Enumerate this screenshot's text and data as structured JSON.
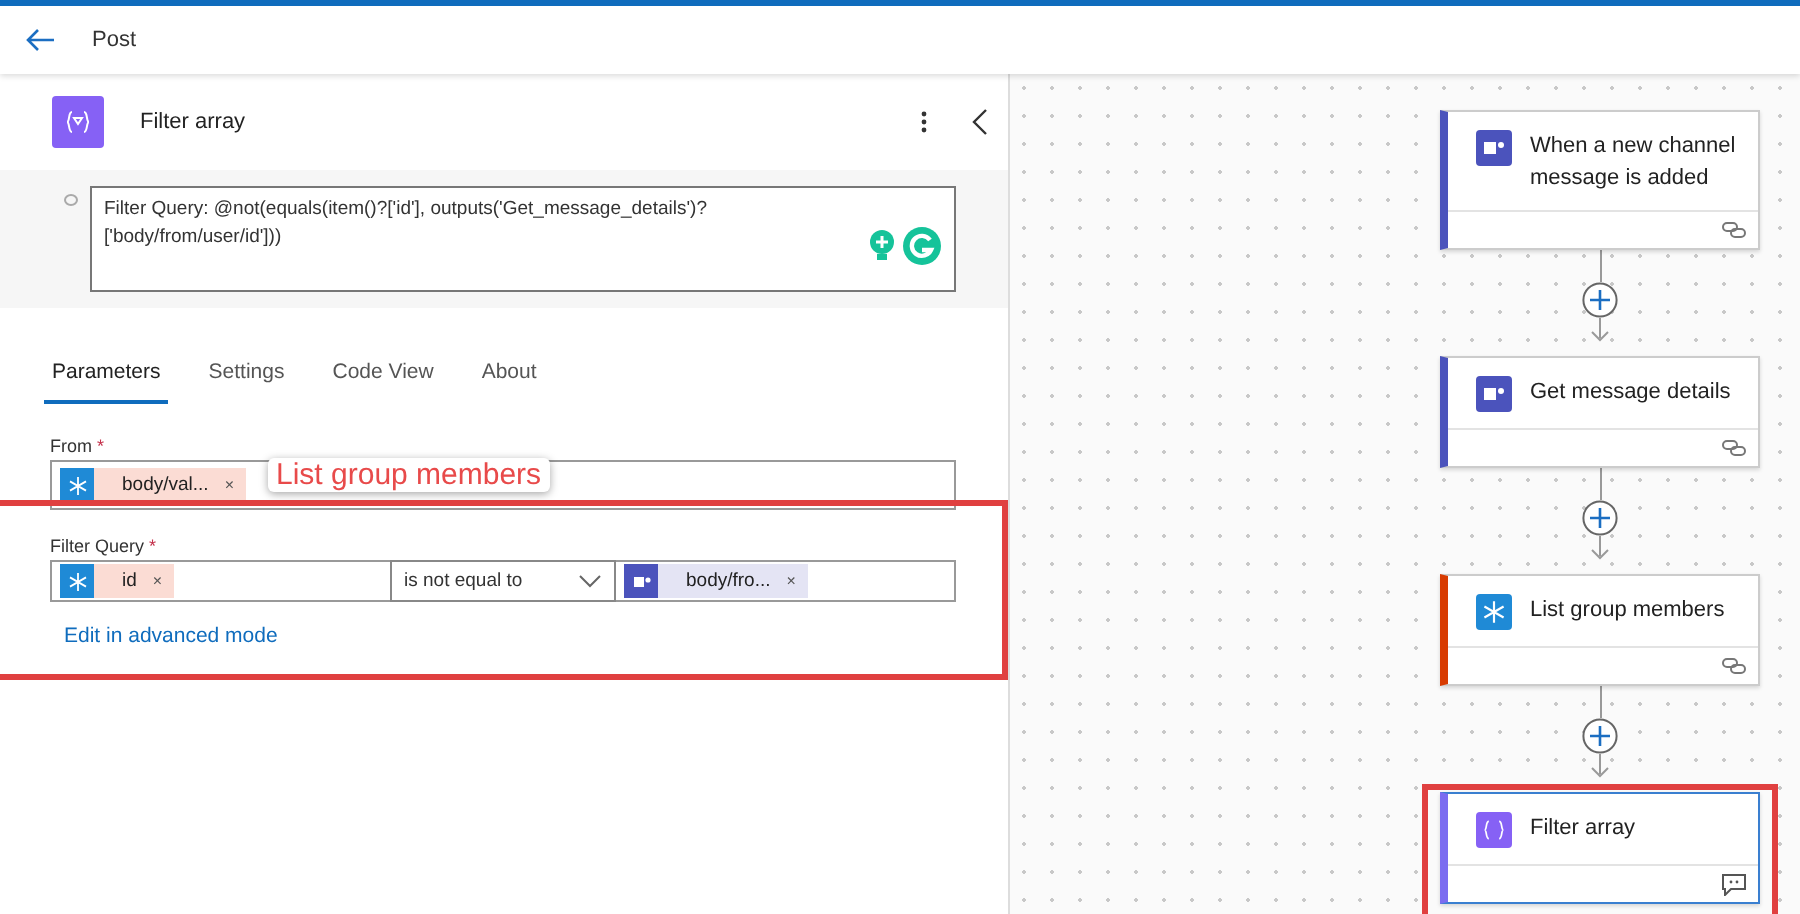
{
  "top_bar": {
    "title": "Post"
  },
  "panel": {
    "title": "Filter array",
    "comment": "Filter Query: @not(equals(item()?['id'], outputs('Get_message_details')?['body/from/user/id']))",
    "tabs": [
      {
        "label": "Parameters",
        "selected": true
      },
      {
        "label": "Settings",
        "selected": false
      },
      {
        "label": "Code View",
        "selected": false
      },
      {
        "label": "About",
        "selected": false
      }
    ],
    "from": {
      "label": "From",
      "required_mark": "*",
      "tokens": [
        {
          "kind": "directory",
          "text": "body/val...",
          "remove": "×"
        }
      ]
    },
    "tooltip": "List group members",
    "filter_query": {
      "label": "Filter Query",
      "required_mark": "*",
      "left": {
        "kind": "directory",
        "text": "id",
        "remove": "×"
      },
      "operator": "is not equal to",
      "right": {
        "kind": "teams",
        "text": "body/fro...",
        "remove": "×"
      },
      "link": "Edit in advanced mode"
    }
  },
  "flow": [
    {
      "kind": "teams",
      "title": "When a new channel message is added",
      "color": "#4b53bc",
      "has_comment": false,
      "selected": false
    },
    {
      "kind": "teams",
      "title": "Get message details",
      "color": "#4b53bc",
      "has_comment": false,
      "selected": false
    },
    {
      "kind": "directory",
      "title": "List group members",
      "color": "#d83b01",
      "has_comment": false,
      "selected": false
    },
    {
      "kind": "filter",
      "title": "Filter array",
      "color": "#7b6cf0",
      "has_comment": true,
      "selected": true
    }
  ]
}
